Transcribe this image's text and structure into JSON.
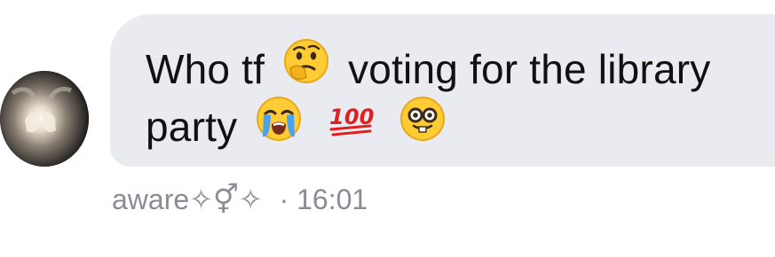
{
  "message": {
    "text_before": "Who tf",
    "text_middle": "voting for the library",
    "text_end": "party",
    "emojis": [
      "thinking-face",
      "loudly-crying-face",
      "hundred-points",
      "nerd-face"
    ]
  },
  "meta": {
    "username": "aware✧⚥✧",
    "separator": "·",
    "time": "16:01"
  },
  "colors": {
    "bubble": "#e9ebf0",
    "text": "#111111",
    "meta": "#888c95",
    "background": "#ffffff"
  }
}
